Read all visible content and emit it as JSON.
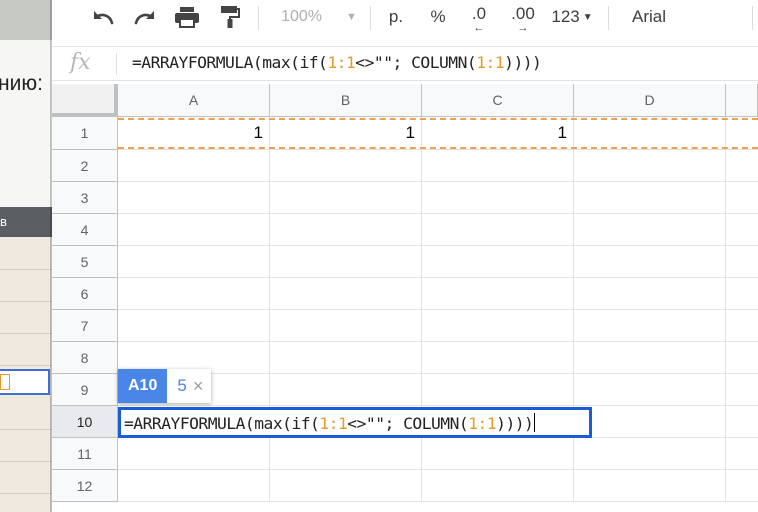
{
  "background_window": {
    "text": "нию:",
    "dark_bar_text": "в"
  },
  "toolbar": {
    "undo_icon": "undo-icon",
    "redo_icon": "redo-icon",
    "print_icon": "print-icon",
    "paint_format_icon": "paint-format-icon",
    "zoom": "100%",
    "currency": "р.",
    "percent": "%",
    "decrease_decimal": ".0",
    "increase_decimal": ".00",
    "number_format": "123",
    "font": "Arial"
  },
  "formula_bar": {
    "fx_label": "fx",
    "formula_prefix": "=ARRAYFORMULA(max(if(",
    "range1": "1:1",
    "formula_mid": "<>\"\"; COLUMN(",
    "range2": "1:1",
    "formula_suffix": "))))"
  },
  "grid": {
    "columns": [
      "A",
      "B",
      "C",
      "D"
    ],
    "rows": [
      "1",
      "2",
      "3",
      "4",
      "5",
      "6",
      "7",
      "8",
      "9",
      "10",
      "11",
      "12"
    ],
    "row1_values": [
      "1",
      "1",
      "1",
      ""
    ]
  },
  "editor": {
    "formula_prefix": "=ARRAYFORMULA(max(if(",
    "range1": "1:1",
    "formula_mid": "<>\"\"; COLUMN(",
    "range2": "1:1",
    "formula_suffix": "))))"
  },
  "hint": {
    "cell_ref": "A10",
    "value": "5",
    "close": "×"
  },
  "colors": {
    "selection_blue": "#1a5bd8",
    "range_orange": "#e69a2d",
    "hint_blue": "#4a86e8"
  }
}
